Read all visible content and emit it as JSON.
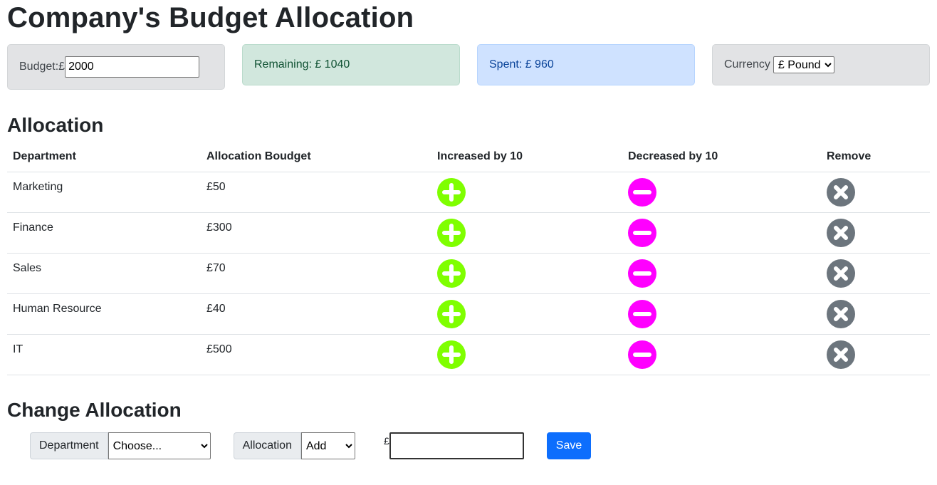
{
  "title": "Company's Budget Allocation",
  "summary": {
    "budget_label": "Budget:£",
    "budget_value": "2000",
    "remaining_text": "Remaining: £ 1040",
    "spent_text": "Spent: £ 960",
    "currency_label": "Currency",
    "currency_selected": "£ Pound"
  },
  "allocation": {
    "heading": "Allocation",
    "columns": [
      "Department",
      "Allocation Boudget",
      "Increased by 10",
      "Decreased by 10",
      "Remove"
    ],
    "rows": [
      {
        "department": "Marketing",
        "budget": "£50"
      },
      {
        "department": "Finance",
        "budget": "£300"
      },
      {
        "department": "Sales",
        "budget": "£70"
      },
      {
        "department": "Human Resource",
        "budget": "£40"
      },
      {
        "department": "IT",
        "budget": "£500"
      }
    ]
  },
  "change": {
    "heading": "Change Allocation",
    "department_label": "Department",
    "department_selected": "Choose...",
    "allocation_label": "Allocation",
    "allocation_selected": "Add",
    "currency_symbol": "£",
    "amount_value": "",
    "save_label": "Save"
  },
  "colors": {
    "increase": "#7fff00",
    "decrease": "#ff00ff",
    "remove": "#6c757d",
    "save": "#0d6efd"
  },
  "icons": {
    "increase": "plus-circle-icon",
    "decrease": "minus-circle-icon",
    "remove": "x-circle-icon"
  }
}
